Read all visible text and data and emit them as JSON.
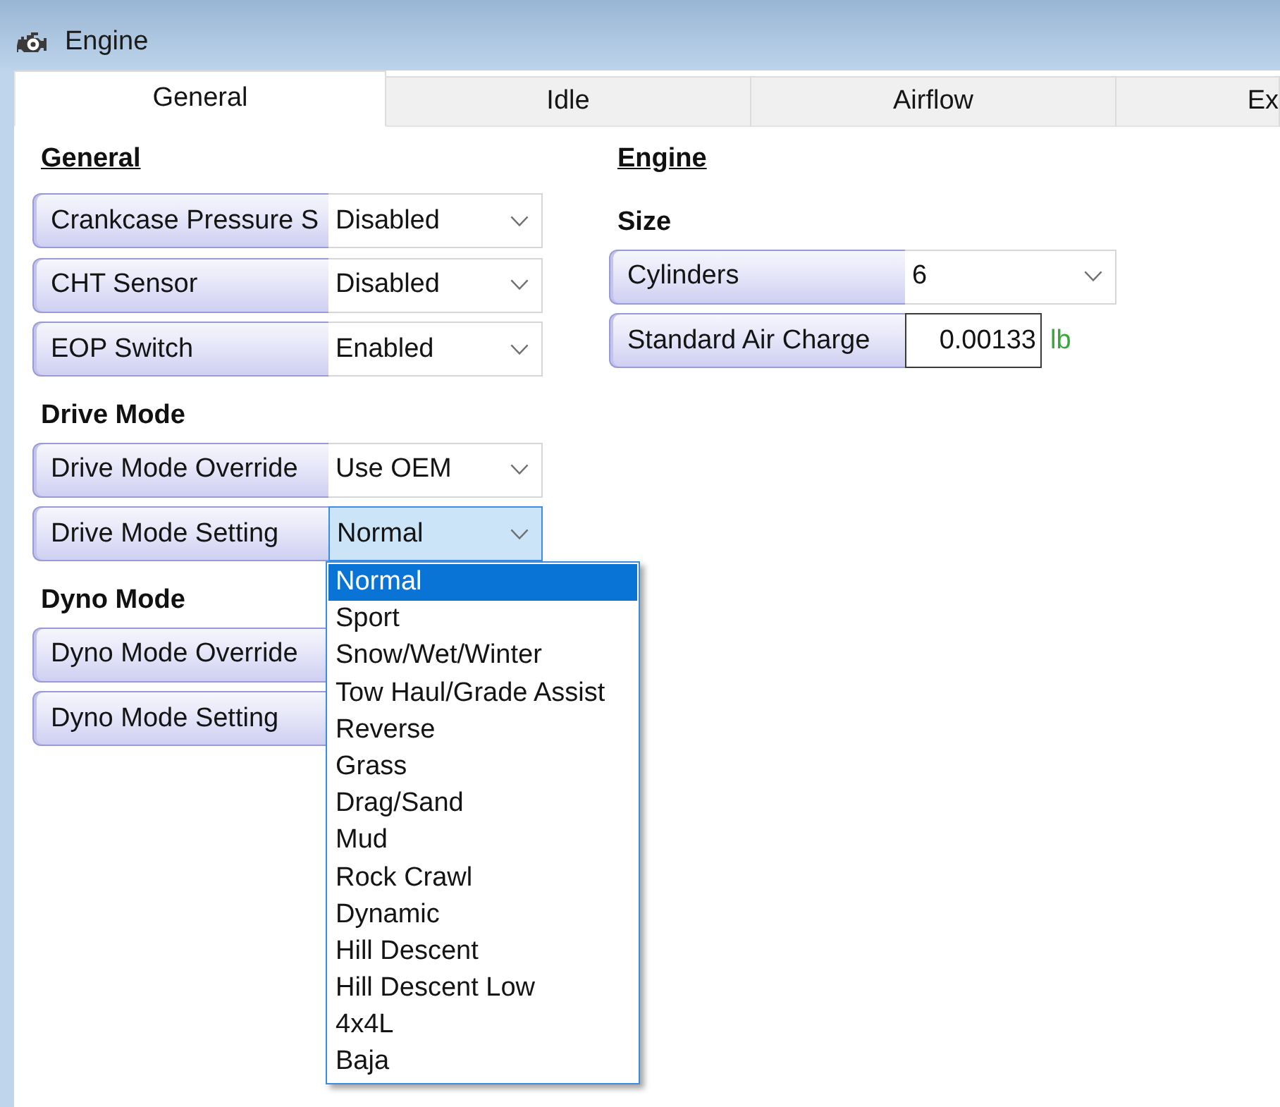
{
  "window": {
    "title": "Engine"
  },
  "tabs": [
    {
      "label": "General",
      "selected": true
    },
    {
      "label": "Idle",
      "selected": false
    },
    {
      "label": "Airflow",
      "selected": false
    },
    {
      "label": "Ex",
      "selected": false
    }
  ],
  "columns": [
    {
      "heading": "General",
      "groups": [
        {
          "rows": [
            {
              "kind": "select",
              "label": "Crankcase Pressure S",
              "value": "Disabled",
              "open": false
            },
            {
              "kind": "select",
              "label": "CHT Sensor",
              "value": "Disabled",
              "open": false
            },
            {
              "kind": "select",
              "label": "EOP Switch",
              "value": "Enabled",
              "open": false
            }
          ]
        },
        {
          "title": "Drive Mode",
          "rows": [
            {
              "kind": "select",
              "label": "Drive Mode Override",
              "value": "Use OEM",
              "open": false
            },
            {
              "kind": "select",
              "label": "Drive Mode Setting",
              "value": "Normal",
              "open": true,
              "options": [
                {
                  "label": "Normal",
                  "selected": true
                },
                {
                  "label": "Sport",
                  "selected": false
                },
                {
                  "label": "Snow/Wet/Winter",
                  "selected": false
                },
                {
                  "label": "Tow Haul/Grade Assist",
                  "selected": false
                },
                {
                  "label": "Reverse",
                  "selected": false
                },
                {
                  "label": "Grass",
                  "selected": false
                },
                {
                  "label": "Drag/Sand",
                  "selected": false
                },
                {
                  "label": "Mud",
                  "selected": false
                },
                {
                  "label": "Rock Crawl",
                  "selected": false
                },
                {
                  "label": "Dynamic",
                  "selected": false
                },
                {
                  "label": "Hill Descent",
                  "selected": false
                },
                {
                  "label": "Hill Descent Low",
                  "selected": false
                },
                {
                  "label": "4x4L",
                  "selected": false
                },
                {
                  "label": "Baja",
                  "selected": false
                }
              ]
            }
          ]
        },
        {
          "title": "Dyno Mode",
          "rows": [
            {
              "kind": "select",
              "label": "Dyno Mode Override"
            },
            {
              "kind": "select",
              "label": "Dyno Mode Setting"
            }
          ]
        }
      ]
    },
    {
      "heading": "Engine",
      "groups": [
        {
          "title": "Size",
          "rows": [
            {
              "kind": "select",
              "label": "Cylinders",
              "value": "6",
              "open": false
            },
            {
              "kind": "number",
              "label": "Standard Air Charge",
              "value": "0.00133",
              "unit": "lb"
            }
          ]
        }
      ]
    }
  ]
}
